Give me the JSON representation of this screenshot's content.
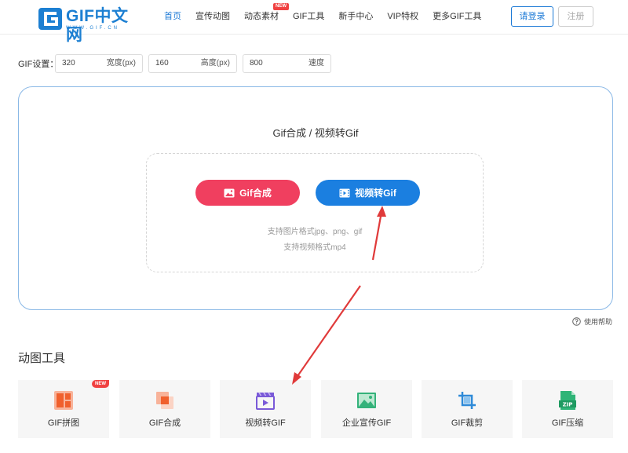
{
  "header": {
    "logo_text": "GIF中文网",
    "logo_sub": "WWW.GIF.CN",
    "nav": [
      {
        "label": "首页",
        "active": true
      },
      {
        "label": "宣传动图"
      },
      {
        "label": "动态素材",
        "badge": "NEW"
      },
      {
        "label": "GIF工具"
      },
      {
        "label": "新手中心"
      },
      {
        "label": "VIP特权"
      },
      {
        "label": "更多GIF工具"
      }
    ],
    "login_label": "请登录",
    "register_label": "注册"
  },
  "settings": {
    "label": "GIF设置：",
    "width_value": "320",
    "width_unit": "宽度(px)",
    "height_value": "160",
    "height_unit": "高度(px)",
    "speed_value": "800",
    "speed_unit": "速度"
  },
  "card": {
    "title": "Gif合成 / 视频转Gif",
    "btn_gif_compose": "Gif合成",
    "btn_video_to_gif": "视频转Gif",
    "hint_images": "支持图片格式jpg、png、gif",
    "hint_video": "支持视频格式mp4"
  },
  "help_label": "使用帮助",
  "tools_section": {
    "title": "动图工具",
    "items": [
      {
        "label": "GIF拼图",
        "icon": "grid-collage-icon",
        "badge": "NEW"
      },
      {
        "label": "GIF合成",
        "icon": "layers-compose-icon"
      },
      {
        "label": "视频转GIF",
        "icon": "video-clapper-icon"
      },
      {
        "label": "企业宣传GIF",
        "icon": "image-landscape-icon"
      },
      {
        "label": "GIF裁剪",
        "icon": "crop-icon"
      },
      {
        "label": "GIF压缩",
        "icon": "zip-file-icon"
      }
    ]
  },
  "colors": {
    "brand_blue": "#1d7ad6",
    "pill_red": "#f03f5f",
    "pill_blue": "#1b7fe0",
    "badge_red": "#f04141",
    "annotation_arrow": "#e03a3a"
  }
}
